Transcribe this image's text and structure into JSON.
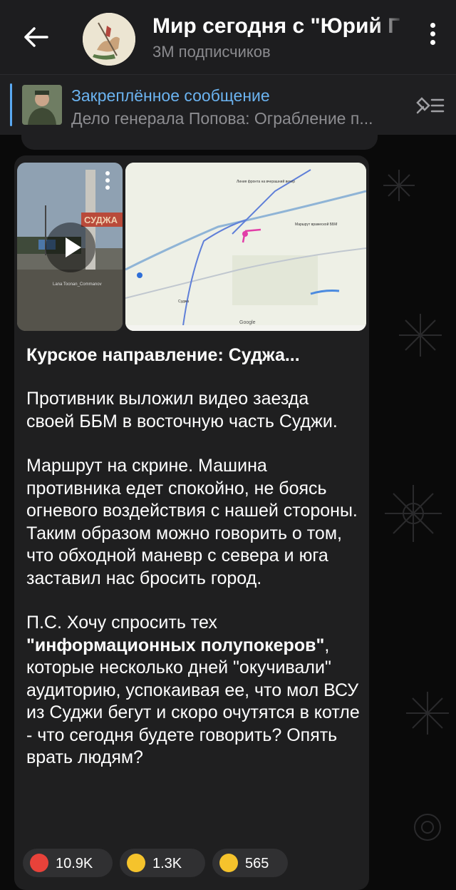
{
  "header": {
    "channel_title": "Мир сегодня с \"Юрий Г",
    "subscribers": "3M подписчиков"
  },
  "pinned": {
    "title": "Закреплённое сообщение",
    "text": "Дело генерала Попова: Ограбление п..."
  },
  "message": {
    "title": "Курское направление: Суджа...",
    "para1": "Противник выложил видео заезда своей ББМ в восточную часть Суджи.",
    "para2": "Маршрут на скрине. Машина противника едет спокойно, не боясь огневого воздействия с нашей стороны. Таким образом можно говорить о том, что обходной маневр с севера и юга заставил нас бросить город.",
    "para3_start": "П.С. Хочу спросить тех ",
    "para3_bold": "\"информационных полупокеров\"",
    "para3_end": ", которые несколько дней \"окучивали\" аудиторию, успокаивая ее, что мол ВСУ из Суджи бегут и скоро очутятся в котле - что сегодня будете говорить? Опять врать людям?"
  },
  "media": {
    "video_sign_text": "СУДЖА",
    "video_watermark": "Lana Toonan_Commanov",
    "map_labels": {
      "route_label": "Маршрут вражеской ББМ",
      "front_label": "Линия фронта на вчерашний вечер",
      "town": "Суджа",
      "google": "Google"
    }
  },
  "reactions": [
    {
      "emoji": "angry-face",
      "count": "10.9K",
      "color": "#e8423a"
    },
    {
      "emoji": "crying-face",
      "count": "1.3K",
      "color": "#f5c32c"
    },
    {
      "emoji": "thumbs-up",
      "count": "565",
      "color": "#f5c32c"
    }
  ],
  "colors": {
    "accent": "#6bb3f0",
    "bubble": "#1f1f20",
    "header": "#1d1d1f"
  }
}
